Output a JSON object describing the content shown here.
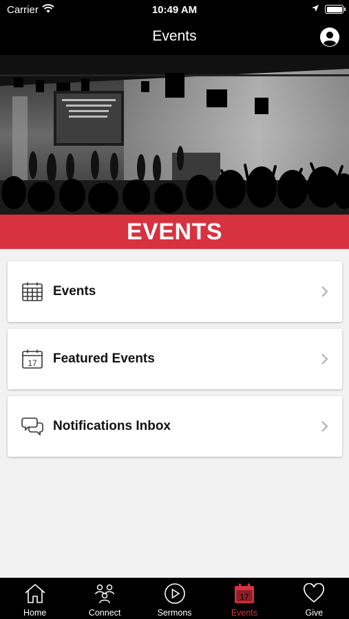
{
  "status_bar": {
    "carrier": "Carrier",
    "time": "10:49 AM"
  },
  "nav": {
    "title": "Events"
  },
  "banner": {
    "text": "EVENTS",
    "color": "#d8313f"
  },
  "menu": [
    {
      "label": "Events",
      "icon": "calendar-grid-icon"
    },
    {
      "label": "Featured Events",
      "icon": "calendar-17-icon"
    },
    {
      "label": "Notifications Inbox",
      "icon": "chat-bubbles-icon"
    }
  ],
  "calendar_day": "17",
  "tabs": [
    {
      "label": "Home",
      "icon": "home-icon",
      "active": false
    },
    {
      "label": "Connect",
      "icon": "people-icon",
      "active": false
    },
    {
      "label": "Sermons",
      "icon": "play-circle-icon",
      "active": false
    },
    {
      "label": "Events",
      "icon": "calendar-icon",
      "active": true
    },
    {
      "label": "Give",
      "icon": "heart-icon",
      "active": false
    }
  ],
  "colors": {
    "accent": "#d8313f",
    "bar_background": "#000000",
    "page_background": "#f2f2f2"
  }
}
